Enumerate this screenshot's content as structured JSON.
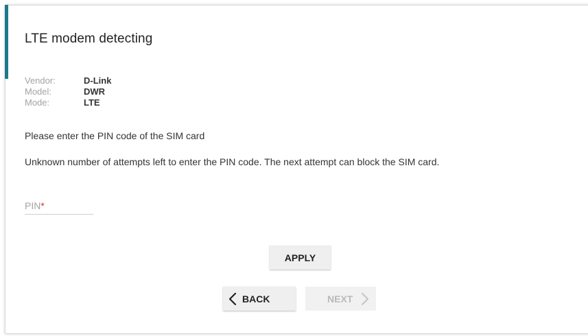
{
  "page": {
    "title": "LTE modem detecting"
  },
  "device_info": [
    {
      "label": "Vendor:",
      "value": "D-Link"
    },
    {
      "label": "Model:",
      "value": "DWR"
    },
    {
      "label": "Mode:",
      "value": "LTE"
    }
  ],
  "messages": {
    "enter_pin": "Please enter the PIN code of the SIM card",
    "attempts_warning": "Unknown number of attempts left to enter the PIN code. The next attempt can block the SIM card."
  },
  "pin_field": {
    "label": "PIN",
    "required_marker": "*",
    "value": ""
  },
  "buttons": {
    "apply": "APPLY",
    "back": "BACK",
    "next": "NEXT"
  },
  "colors": {
    "accent": "#1b7b8c",
    "required": "#e03030",
    "button_bg": "#efefef",
    "disabled_text": "#b9b9b9"
  },
  "icons": {
    "back": "chevron-left-icon",
    "next": "chevron-right-icon"
  }
}
